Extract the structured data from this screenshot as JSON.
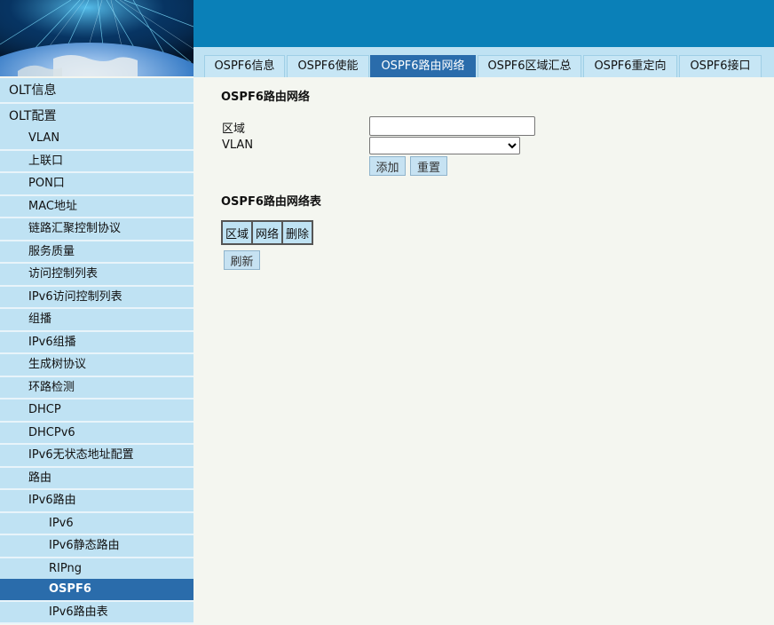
{
  "tabs": [
    {
      "label": "OSPF6信息"
    },
    {
      "label": "OSPF6使能"
    },
    {
      "label": "OSPF6路由网络"
    },
    {
      "label": "OSPF6区域汇总"
    },
    {
      "label": "OSPF6重定向"
    },
    {
      "label": "OSPF6接口"
    }
  ],
  "active_tab": "OSPF6路由网络",
  "sidebar": {
    "items": [
      {
        "label": "OLT信息"
      },
      {
        "label": "OLT配置"
      },
      {
        "label": "VLAN"
      },
      {
        "label": "上联口"
      },
      {
        "label": "PON口"
      },
      {
        "label": "MAC地址"
      },
      {
        "label": "链路汇聚控制协议"
      },
      {
        "label": "服务质量"
      },
      {
        "label": "访问控制列表"
      },
      {
        "label": "IPv6访问控制列表"
      },
      {
        "label": "组播"
      },
      {
        "label": "IPv6组播"
      },
      {
        "label": "生成树协议"
      },
      {
        "label": "环路检测"
      },
      {
        "label": "DHCP"
      },
      {
        "label": "DHCPv6"
      },
      {
        "label": "IPv6无状态地址配置"
      },
      {
        "label": "路由"
      },
      {
        "label": "IPv6路由"
      },
      {
        "label": "IPv6"
      },
      {
        "label": "IPv6静态路由"
      },
      {
        "label": "RIPng"
      },
      {
        "label": "OSPF6"
      },
      {
        "label": "IPv6路由表"
      }
    ],
    "active_item": "OSPF6"
  },
  "form": {
    "title": "OSPF6路由网络",
    "area_label": "区域",
    "area_value": "",
    "vlan_label": "VLAN",
    "vlan_value": "",
    "add_label": "添加",
    "reset_label": "重置"
  },
  "table": {
    "title": "OSPF6路由网络表",
    "columns": [
      "区域",
      "网络",
      "删除"
    ],
    "rows": [],
    "refresh_label": "刷新"
  },
  "colors": {
    "topbar": "#0a80b8",
    "active": "#2a6cab",
    "nav_bg": "#bfe2f3",
    "page_bg": "#f4f6f0"
  }
}
